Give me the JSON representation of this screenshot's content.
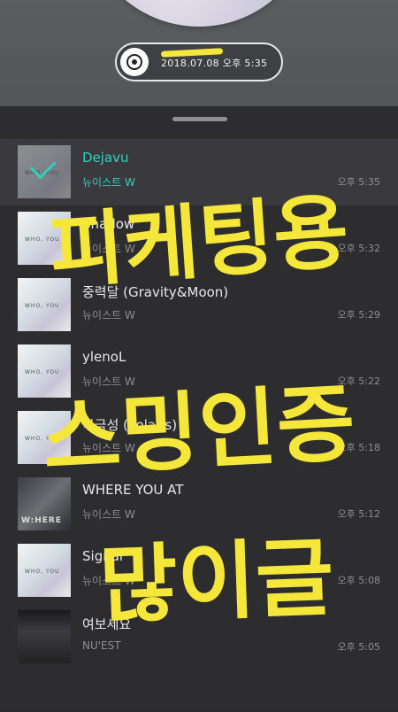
{
  "now_playing": {
    "timestamp": "2018.07.08 오후 5:35"
  },
  "history": [
    {
      "title": "Dejavu",
      "artist": "뉴이스트 W",
      "time": "오후 5:35",
      "active": true,
      "cover_text": "WHO, YOU"
    },
    {
      "title": "Shadow",
      "artist": "뉴이스트 W",
      "time": "오후 5:32",
      "cover_text": "WHO, YOU"
    },
    {
      "title": "중력달 (Gravity&Moon)",
      "artist": "뉴이스트 W",
      "time": "오후 5:29",
      "cover_text": "WHO, YOU"
    },
    {
      "title": "ylenoL",
      "artist": "뉴이스트 W",
      "time": "오후 5:22",
      "cover_text": "WHO, YOU"
    },
    {
      "title": "북극성 (Polaris)",
      "artist": "뉴이스트 W",
      "time": "오후 5:18",
      "cover_text": "WHO, YOU"
    },
    {
      "title": "WHERE YOU AT",
      "artist": "뉴이스트 W",
      "time": "오후 5:12",
      "cover_text": "W:HERE"
    },
    {
      "title": "Signal",
      "artist": "뉴이스트 W",
      "time": "오후 5:08",
      "cover_text": "WHO, YOU"
    },
    {
      "title": "여보세요",
      "artist": "NU'EST",
      "time": "오후 5:05",
      "cover_text": ""
    }
  ],
  "handwriting_overlay": {
    "lines": [
      "피케팅용",
      "스밍인증",
      "많이글"
    ],
    "color": "#f5e63a"
  },
  "colors": {
    "accent": "#2fd1c0",
    "background": "#2d2d2f",
    "marker": "#f5e63a"
  }
}
